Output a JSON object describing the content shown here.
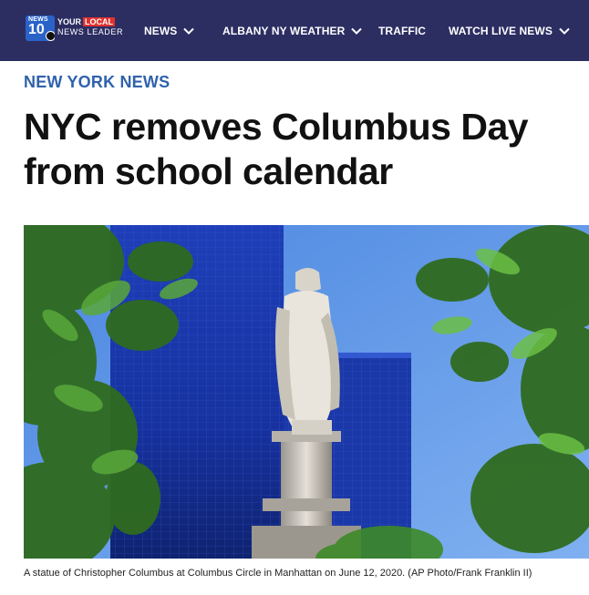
{
  "brand": {
    "logo_news": "NEWS",
    "logo_number": "10",
    "tagline_your": "YOUR",
    "tagline_local": "LOCAL",
    "tagline_leader": "NEWS LEADER",
    "nav_color": "#2c2e62",
    "accent_red": "#e0312e"
  },
  "nav": {
    "items": [
      {
        "label": "NEWS",
        "has_dropdown": true,
        "icon": "chevron-down-icon"
      },
      {
        "label": "ALBANY NY WEATHER",
        "has_dropdown": true,
        "icon": "chevron-down-icon"
      },
      {
        "label": "TRAFFIC",
        "has_dropdown": false
      },
      {
        "label": "WATCH LIVE NEWS",
        "has_dropdown": true,
        "icon": "chevron-down-icon"
      }
    ]
  },
  "article": {
    "section": "NEW YORK NEWS",
    "section_color": "#2f62ad",
    "headline": "NYC removes Columbus Day from school calendar",
    "image_caption": "A statue of Christopher Columbus at Columbus Circle in Manhattan on June 12, 2020. (AP Photo/Frank Franklin II)"
  }
}
